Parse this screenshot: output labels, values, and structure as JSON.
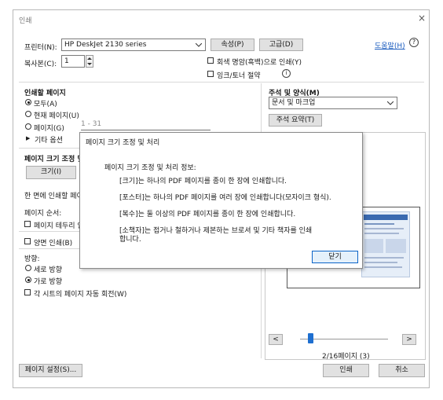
{
  "window": {
    "title": "인쇄",
    "close_icon": "×"
  },
  "printer": {
    "label": "프린터(N):",
    "value": "HP DeskJet 2130 series",
    "properties": "속성(P)",
    "advanced": "고급(D)",
    "help": "도움말(H)",
    "help_icon": "?"
  },
  "copies": {
    "label": "복사본(C):",
    "value": "1"
  },
  "options": {
    "grayscale": "회색 명암(흑백)으로 인쇄(Y)",
    "ink_save": "잉크/토너 절약"
  },
  "pages": {
    "heading": "인쇄할 페이지",
    "all": "모두(A)",
    "current": "현재 페이지(U)",
    "pages_label": "페이지(G)",
    "pages_value": "1 - 31",
    "more": "기타 옵션"
  },
  "sizing": {
    "heading": "페이지 크기 조정 및",
    "size_button": "크기(I)",
    "per_sheet": "한 면에 인쇄할 페이",
    "order_label": "페이지 순서:",
    "borders": "페이지 테두리 인"
  },
  "duplex": {
    "label": "양면 인쇄(B)"
  },
  "orientation": {
    "heading": "방향:",
    "portrait": "세로 방향",
    "landscape": "가로 방향",
    "auto_rotate": "각 시트의 페이지 자동 회전(W)"
  },
  "comments": {
    "heading": "주석 및 양식(M)",
    "value": "문서 및 마크업",
    "summarize": "주석 요약(T)"
  },
  "preview": {
    "page_indicator": "2/16페이지 (3)",
    "prev": "<",
    "next": ">",
    "slider_fraction": 0.09
  },
  "footer": {
    "page_setup": "페이지 설정(S)...",
    "print": "인쇄",
    "cancel": "취소"
  },
  "popup": {
    "title": "페이지 크기 조정 및 처리",
    "info_heading": "페이지 크기 조정 및 처리 정보:",
    "line1": "[크기]는 하나의 PDF 페이지를 종이 한 장에 인쇄합니다.",
    "line2": "[포스터]는 하나의 PDF 페이지를 여러 장에 인쇄합니다(모자이크 형식).",
    "line3": "[복수]는 둘 이상의 PDF 페이지를 종이 한 장에 인쇄합니다.",
    "line4a": "[소책자]는 접거나 철하거나 제본하는 브로셔 및 기타 책자를 인쇄",
    "line4b": "합니다.",
    "close": "닫기"
  }
}
